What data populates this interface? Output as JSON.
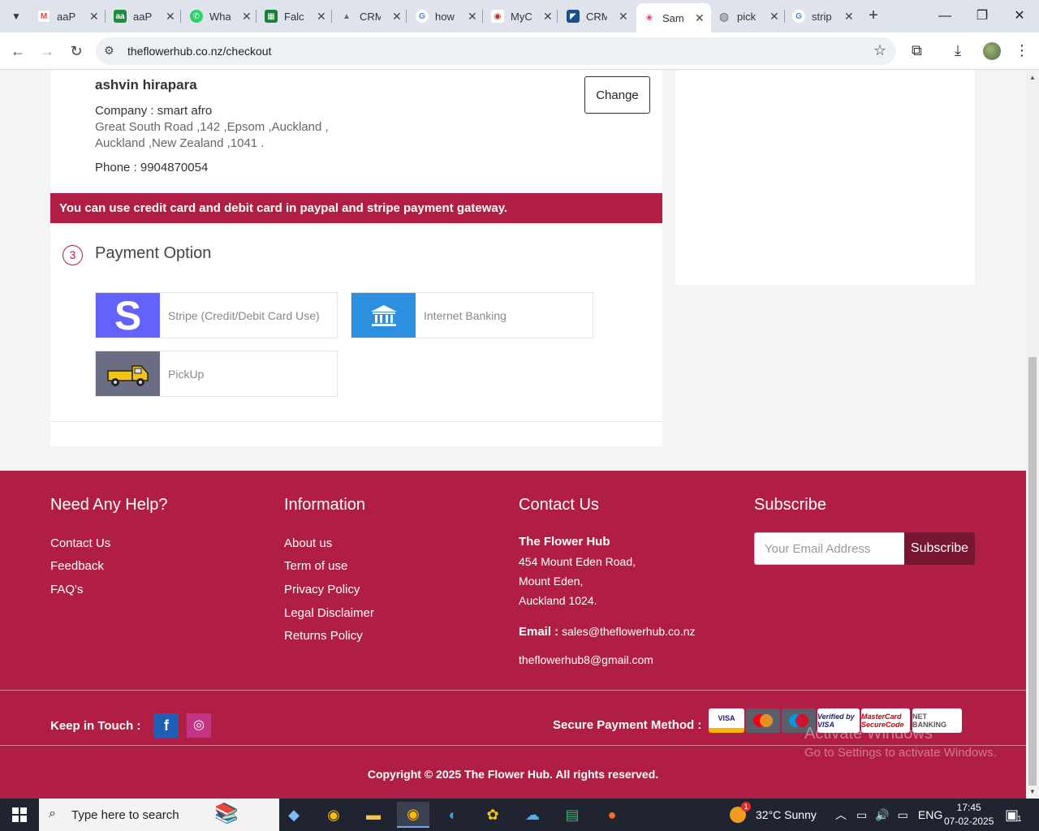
{
  "browser": {
    "tabs": [
      {
        "title": "aaP",
        "favicon": "gmail-icon",
        "color": "#ea4335",
        "glyph": "M"
      },
      {
        "title": "aaP",
        "favicon": "aa-icon",
        "color": "#1e8e3e",
        "glyph": "aa"
      },
      {
        "title": "Wha",
        "favicon": "whatsapp-icon",
        "color": "#25d366",
        "glyph": "✆"
      },
      {
        "title": "Falc",
        "favicon": "sheets-icon",
        "color": "#188038",
        "glyph": "▦"
      },
      {
        "title": "CRM",
        "favicon": "crm-icon",
        "color": "#5f6b7a",
        "glyph": "▲"
      },
      {
        "title": "how",
        "favicon": "google-icon",
        "color": "#4285f4",
        "glyph": "G"
      },
      {
        "title": "MyC",
        "favicon": "myc-icon",
        "color": "#c5221f",
        "glyph": "◉"
      },
      {
        "title": "CRM",
        "favicon": "crm2-icon",
        "color": "#1a4f8b",
        "glyph": "◤"
      },
      {
        "title": "Sam",
        "favicon": "flower-icon",
        "color": "#d93a5a",
        "glyph": "❀",
        "active": true
      },
      {
        "title": "pick",
        "favicon": "globe-icon",
        "color": "#5f6368",
        "glyph": "◍"
      },
      {
        "title": "strip",
        "favicon": "google-icon",
        "color": "#4285f4",
        "glyph": "G"
      }
    ],
    "url": "theflowerhub.co.nz/checkout"
  },
  "address": {
    "name": "ashvin hirapara",
    "company": "Company : smart afro",
    "line1": "Great South Road ,142 ,Epsom ,Auckland ,",
    "line2": "Auckland ,New Zealand ,1041 .",
    "phone": "Phone : 9904870054",
    "change_label": "Change"
  },
  "notice": "You can use credit card and debit card in paypal and stripe payment gateway.",
  "payment": {
    "step": "3",
    "title": "Payment Option",
    "options": [
      {
        "label": "Stripe (Credit/Debit Card Use)",
        "icon": "stripe-icon"
      },
      {
        "label": "Internet Banking",
        "icon": "bank-icon"
      },
      {
        "label": "PickUp",
        "icon": "pickup-truck-icon"
      }
    ]
  },
  "footer": {
    "help_title": "Need Any Help?",
    "help_links": [
      "Contact Us",
      "Feedback",
      "FAQ's"
    ],
    "info_title": "Information",
    "info_links": [
      "About us",
      "Term of use",
      "Privacy Policy",
      "Legal Disclaimer",
      "Returns Policy"
    ],
    "contact_title": "Contact Us",
    "company": "The Flower Hub",
    "addr1": "454 Mount Eden Road,",
    "addr2": "Mount Eden,",
    "addr3": "Auckland 1024.",
    "email_label": "Email :",
    "email1": "sales@theflowerhub.co.nz",
    "email2": "theflowerhub8@gmail.com",
    "subscribe_title": "Subscribe",
    "email_placeholder": "Your Email Address",
    "subscribe_button": "Subscribe",
    "keep_in_touch": "Keep in Touch :",
    "secure_payment": "Secure Payment Method :",
    "payment_logos": [
      "VISA",
      "MasterCard",
      "Maestro",
      "Verified by VISA",
      "MasterCard SecureCode",
      "NET BANKING"
    ],
    "copyright": "Copyright © 2025 The Flower Hub. All rights reserved."
  },
  "watermark": {
    "line1": "Activate Windows",
    "line2": "Go to Settings to activate Windows."
  },
  "taskbar": {
    "search_placeholder": "Type here to search",
    "weather": "32°C  Sunny",
    "weather_badge": "1",
    "lang": "ENG",
    "time": "17:45",
    "date": "07-02-2025",
    "notif_count": "1"
  },
  "colors": {
    "brand": "#b01e45",
    "stripe": "#6461fc",
    "bank": "#2d8fe0"
  }
}
